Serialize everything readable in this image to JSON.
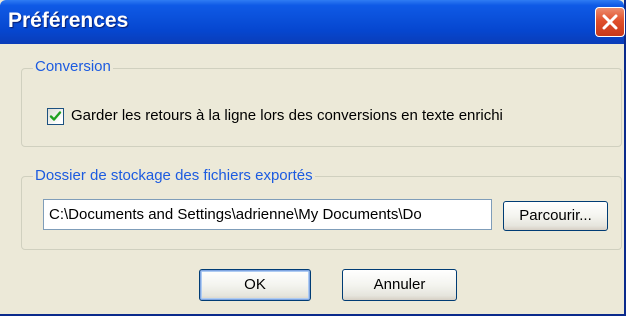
{
  "dialog": {
    "title": "Préférences",
    "close_icon": "close-icon"
  },
  "conversion": {
    "legend": "Conversion",
    "checkbox_checked": true,
    "checkbox_label": "Garder les retours à la ligne lors des conversions en texte enrichi"
  },
  "storage": {
    "legend": "Dossier de stockage des fichiers exportés",
    "path_value": "C:\\Documents and Settings\\adrienne\\My Documents\\Do",
    "browse_label": "Parcourir..."
  },
  "buttons": {
    "ok_label": "OK",
    "cancel_label": "Annuler"
  },
  "colors": {
    "titlebar": "#0a4fd9",
    "legend_text": "#1c5be0",
    "close_button": "#e0502c",
    "checkmark": "#21a121"
  }
}
